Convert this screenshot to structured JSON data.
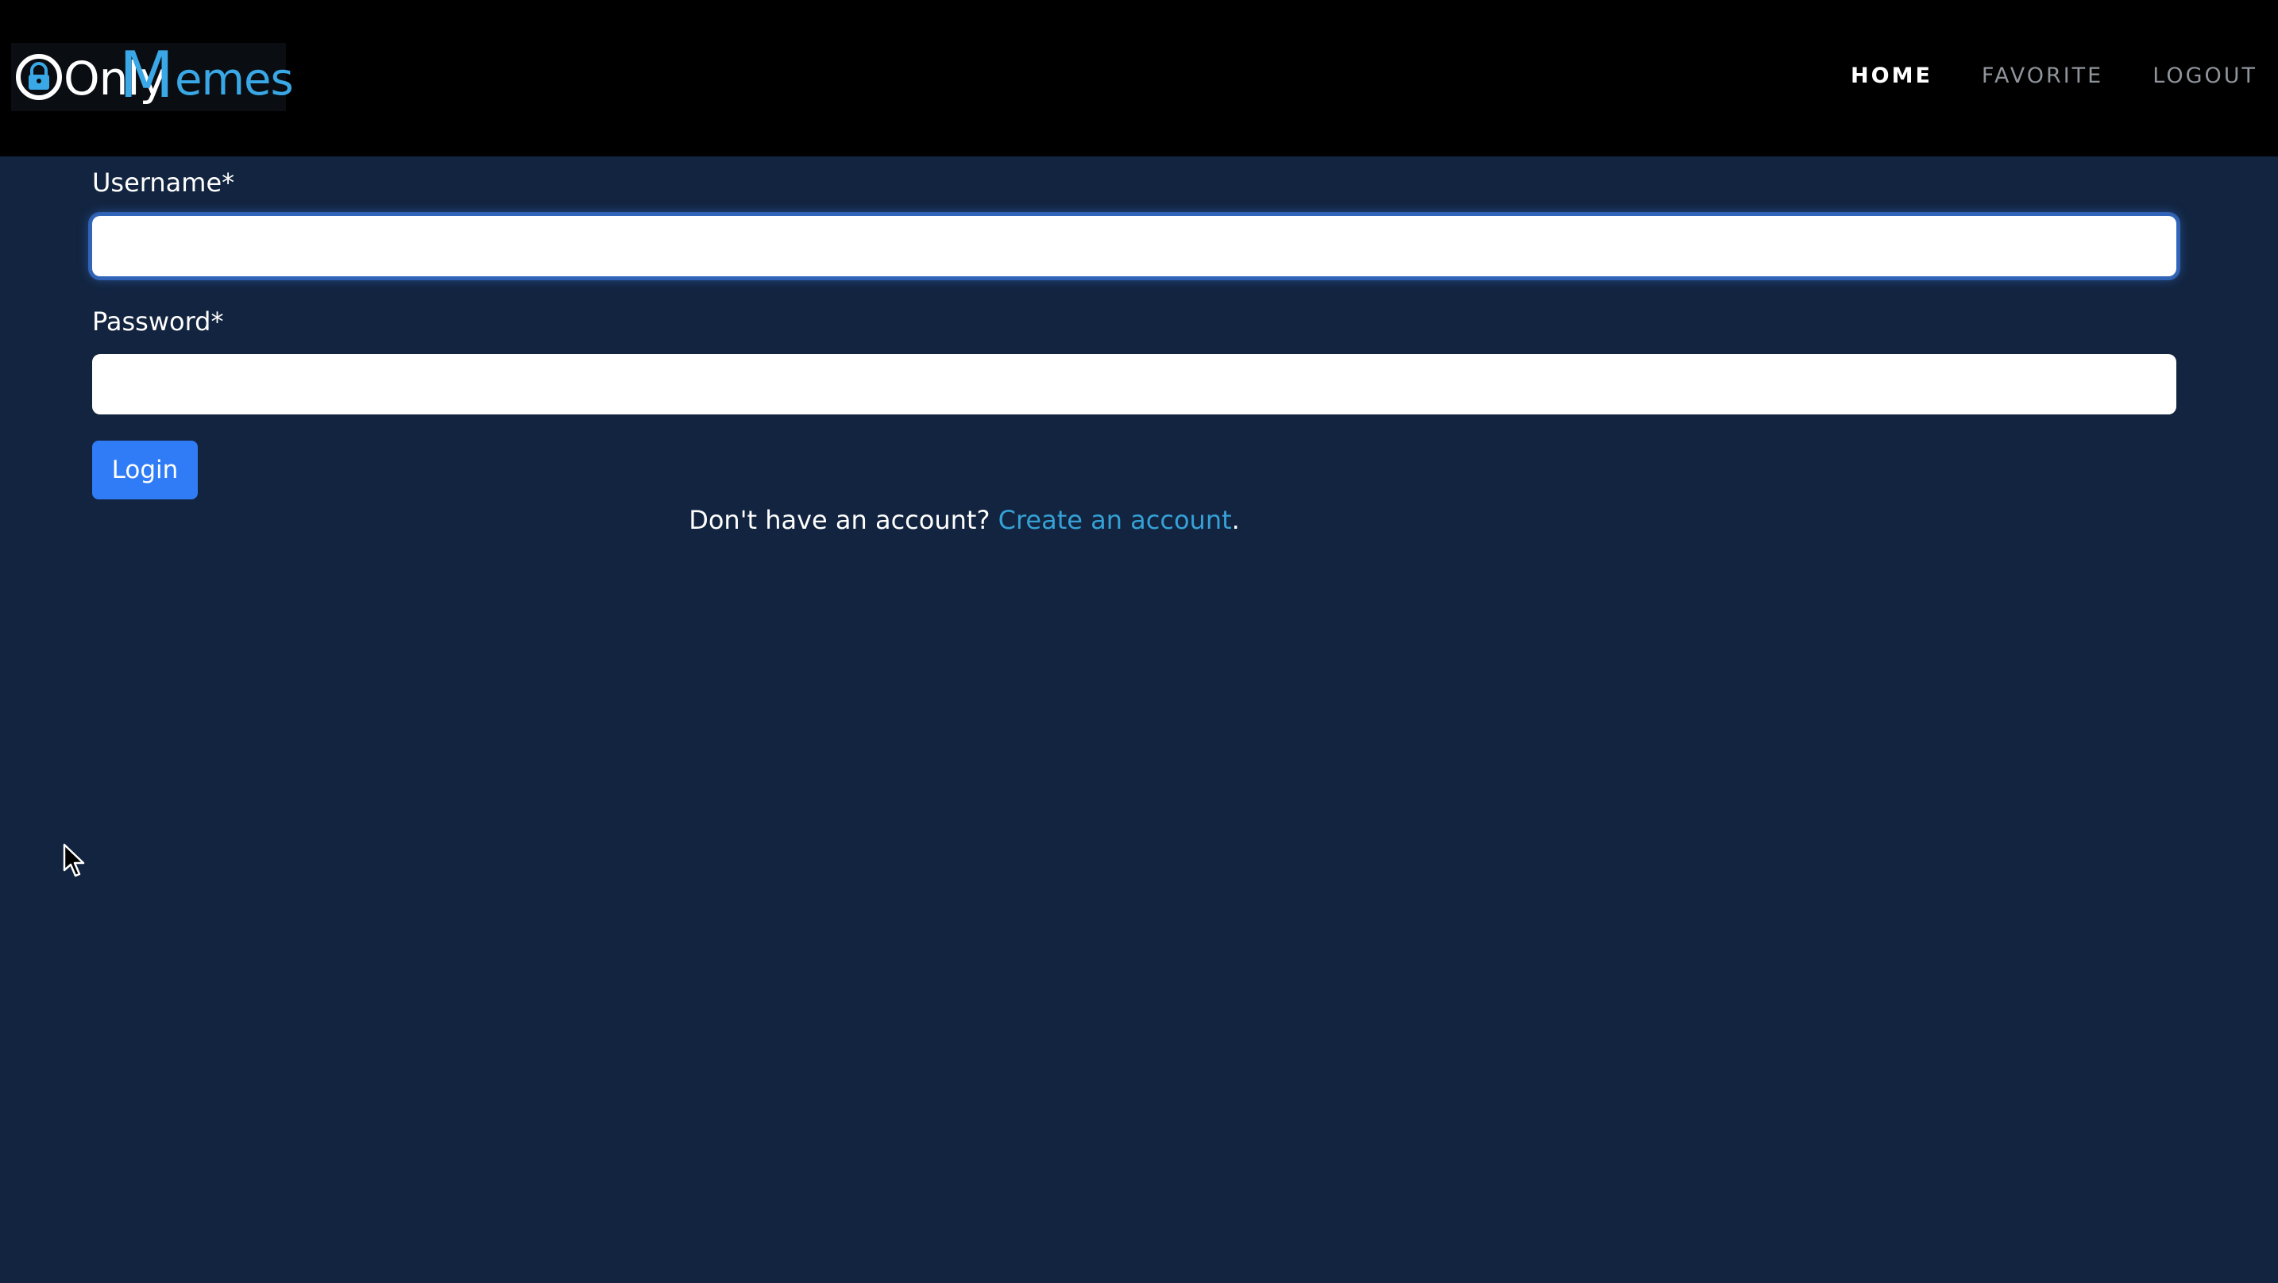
{
  "brand": {
    "logo_prefix": "Only",
    "logo_m": "M",
    "logo_suffix": "emes",
    "accent_color": "#3aa8e6"
  },
  "nav": {
    "items": [
      {
        "label": "HOME",
        "active": true
      },
      {
        "label": "FAVORITE",
        "active": false
      },
      {
        "label": "LOGOUT",
        "active": false
      }
    ]
  },
  "form": {
    "username": {
      "label": "Username*",
      "value": "",
      "placeholder": ""
    },
    "password": {
      "label": "Password*",
      "value": "",
      "placeholder": ""
    },
    "login_label": "Login",
    "button_color": "#2f7cf6"
  },
  "signup": {
    "prompt": "Don't have an account?",
    "link_text": "Create an account",
    "suffix": "."
  },
  "icons": {
    "logo": "lock-icon",
    "pointer": "mouse-cursor-icon"
  },
  "colors": {
    "background": "#12243f",
    "navbar": "#000000",
    "link": "#36a1d6"
  }
}
